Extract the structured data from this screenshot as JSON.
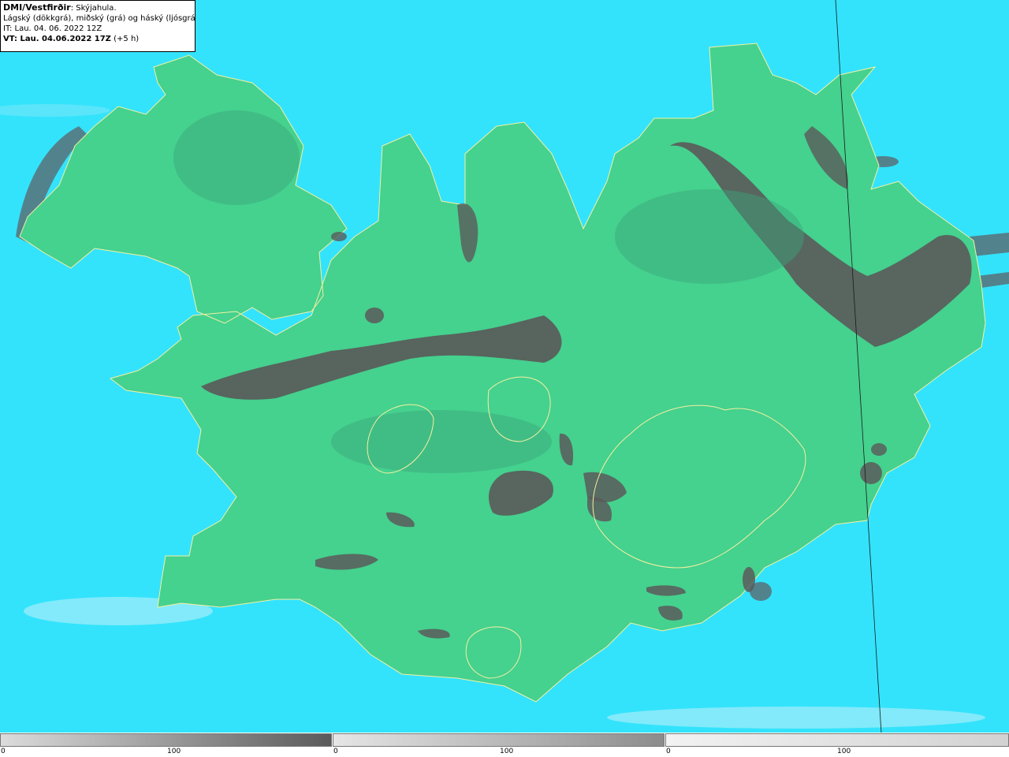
{
  "header": {
    "source": "DMI/Vestfirðir",
    "product": ": Skýjahula.",
    "description": "Lágský (dökkgrá), miðský (grá) og háský (ljósgrá)",
    "issue_time": "IT: Lau. 04. 06. 2022 12Z",
    "valid_time": "VT: Lau. 04.06.2022 17Z",
    "lead": " (+5 h)"
  },
  "legend": [
    {
      "name": "low-cloud",
      "min": "0",
      "max": "100",
      "color": "#5a5a5a"
    },
    {
      "name": "mid-cloud",
      "min": "0",
      "max": "100",
      "color": "#8c8c8c"
    },
    {
      "name": "high-cloud",
      "min": "0",
      "max": "100",
      "color": "#d2d2d2"
    }
  ],
  "colors": {
    "sea": "#33e3fc",
    "land": "#45d18e",
    "low_cloud": "#5a5a5a",
    "coast": "#f5f0a0"
  }
}
